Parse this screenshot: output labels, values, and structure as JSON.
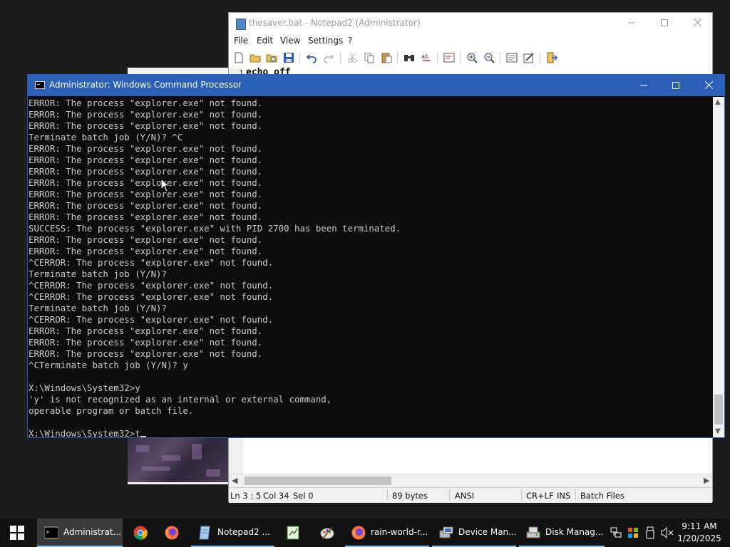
{
  "notepad": {
    "title": "thesaver.bat - Notepad2 (Administrator)",
    "menu": [
      "File",
      "Edit",
      "View",
      "Settings",
      "?"
    ],
    "line_number": "1",
    "code_line": "echo off",
    "status": {
      "position": "Ln 3 : 5",
      "col": "Col 34",
      "sel": "Sel 0",
      "size": "89 bytes",
      "encoding": "ANSI",
      "eol": "CR+LF",
      "ins": "INS",
      "scheme": "Batch Files"
    }
  },
  "cmd": {
    "title": "Administrator: Windows Command Processor",
    "lines": [
      "ERROR: The process \"explorer.exe\" not found.",
      "ERROR: The process \"explorer.exe\" not found.",
      "ERROR: The process \"explorer.exe\" not found.",
      "Terminate batch job (Y/N)? ^C",
      "ERROR: The process \"explorer.exe\" not found.",
      "ERROR: The process \"explorer.exe\" not found.",
      "ERROR: The process \"explorer.exe\" not found.",
      "ERROR: The process \"explorer.exe\" not found.",
      "ERROR: The process \"explorer.exe\" not found.",
      "ERROR: The process \"explorer.exe\" not found.",
      "ERROR: The process \"explorer.exe\" not found.",
      "SUCCESS: The process \"explorer.exe\" with PID 2700 has been terminated.",
      "ERROR: The process \"explorer.exe\" not found.",
      "ERROR: The process \"explorer.exe\" not found.",
      "^CERROR: The process \"explorer.exe\" not found.",
      "Terminate batch job (Y/N)?",
      "^CERROR: The process \"explorer.exe\" not found.",
      "^CERROR: The process \"explorer.exe\" not found.",
      "Terminate batch job (Y/N)?",
      "^CERROR: The process \"explorer.exe\" not found.",
      "ERROR: The process \"explorer.exe\" not found.",
      "ERROR: The process \"explorer.exe\" not found.",
      "ERROR: The process \"explorer.exe\" not found.",
      "^CTerminate batch job (Y/N)? y",
      "",
      "X:\\Windows\\System32>y",
      "'y' is not recognized as an internal or external command,",
      "operable program or batch file.",
      ""
    ],
    "prompt": "X:\\Windows\\System32>t"
  },
  "taskbar": {
    "items": [
      {
        "label": "Administrat...",
        "icon": "cmd-icon"
      },
      {
        "label": "",
        "icon": "chrome-icon"
      },
      {
        "label": "",
        "icon": "firefox-icon"
      },
      {
        "label": "Notepad2 ...",
        "icon": "notepad2-icon"
      },
      {
        "label": "",
        "icon": "spreadsheet-icon"
      },
      {
        "label": "",
        "icon": "paint-icon"
      },
      {
        "label": "rain-world-r...",
        "icon": "firefox-icon"
      },
      {
        "label": "Device Man...",
        "icon": "device-manager-icon"
      },
      {
        "label": "Disk Manag...",
        "icon": "disk-management-icon"
      }
    ],
    "time": "9:11 AM",
    "date": "1/20/2025"
  },
  "colors": {
    "cmd_titlebar": "#2a60b8",
    "cmd_background": "#0c0c0c",
    "cmd_text": "#cccccc",
    "taskbar": "#121212",
    "taskbar_accent": "#76b9ed"
  }
}
